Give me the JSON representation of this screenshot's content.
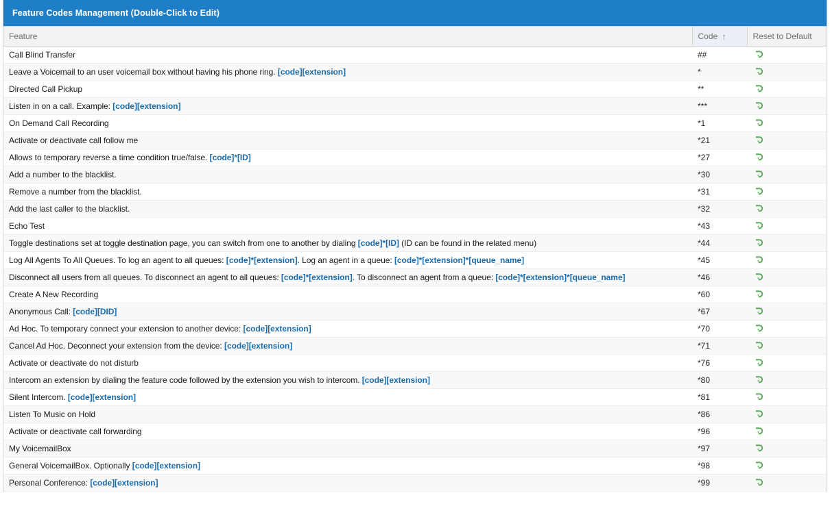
{
  "window": {
    "title": "Feature Codes Management (Double-Click to Edit)",
    "title_bar_color": "#1e7ec8"
  },
  "colors": {
    "accent": "#1e7ec8",
    "token_link": "#1b6cac",
    "reset_icon": "#5aad5a",
    "header_bg": "#f2f2f2",
    "sorted_header_bg": "#eaf0f6",
    "row_alt_bg": "#f8f8f8"
  },
  "table": {
    "columns": [
      {
        "key": "feature",
        "label": "Feature",
        "sorted": false
      },
      {
        "key": "code",
        "label": "Code",
        "sorted": true,
        "sort_direction": "ascending",
        "sort_glyph": "↑"
      },
      {
        "key": "reset",
        "label": "Reset to Default",
        "sorted": false
      }
    ],
    "reset_icon_name": "reset-arrow-icon",
    "rows": [
      {
        "parts": [
          {
            "text": "Call Blind Transfer",
            "type": "plain"
          }
        ],
        "code": "##"
      },
      {
        "parts": [
          {
            "text": "Leave a Voicemail to an user voicemail box without having his phone ring. ",
            "type": "plain"
          },
          {
            "text": "[code][extension]",
            "type": "token"
          }
        ],
        "code": "*"
      },
      {
        "parts": [
          {
            "text": "Directed Call Pickup",
            "type": "plain"
          }
        ],
        "code": "**"
      },
      {
        "parts": [
          {
            "text": "Listen in on a call. Example: ",
            "type": "plain"
          },
          {
            "text": "[code][extension]",
            "type": "token"
          }
        ],
        "code": "***"
      },
      {
        "parts": [
          {
            "text": "On Demand Call Recording",
            "type": "plain"
          }
        ],
        "code": "*1"
      },
      {
        "parts": [
          {
            "text": "Activate or deactivate call follow me",
            "type": "plain"
          }
        ],
        "code": "*21"
      },
      {
        "parts": [
          {
            "text": "Allows to temporary reverse a time condition true/false. ",
            "type": "plain"
          },
          {
            "text": "[code]*[ID]",
            "type": "token"
          }
        ],
        "code": "*27"
      },
      {
        "parts": [
          {
            "text": "Add a number to the blacklist.",
            "type": "plain"
          }
        ],
        "code": "*30"
      },
      {
        "parts": [
          {
            "text": "Remove a number from the blacklist.",
            "type": "plain"
          }
        ],
        "code": "*31"
      },
      {
        "parts": [
          {
            "text": "Add the last caller to the blacklist.",
            "type": "plain"
          }
        ],
        "code": "*32"
      },
      {
        "parts": [
          {
            "text": "Echo Test",
            "type": "plain"
          }
        ],
        "code": "*43"
      },
      {
        "parts": [
          {
            "text": "Toggle destinations set at toggle destination page, you can switch from one to another by dialing ",
            "type": "plain"
          },
          {
            "text": "[code]*[ID]",
            "type": "token"
          },
          {
            "text": " (ID can be found in the related menu)",
            "type": "plain"
          }
        ],
        "code": "*44"
      },
      {
        "parts": [
          {
            "text": "Log All Agents To All Queues. To log an agent to all queues: ",
            "type": "plain"
          },
          {
            "text": "[code]*[extension]",
            "type": "token"
          },
          {
            "text": ". Log an agent in a queue: ",
            "type": "plain"
          },
          {
            "text": "[code]*[extension]*[queue_name]",
            "type": "token"
          }
        ],
        "code": "*45"
      },
      {
        "parts": [
          {
            "text": "Disconnect all users from all queues. To disconnect an agent to all queues: ",
            "type": "plain"
          },
          {
            "text": "[code]*[extension]",
            "type": "token"
          },
          {
            "text": ". To disconnect an agent from a queue: ",
            "type": "plain"
          },
          {
            "text": "[code]*[extension]*[queue_name]",
            "type": "token"
          }
        ],
        "code": "*46"
      },
      {
        "parts": [
          {
            "text": "Create A New Recording",
            "type": "plain"
          }
        ],
        "code": "*60"
      },
      {
        "parts": [
          {
            "text": "Anonymous Call: ",
            "type": "plain"
          },
          {
            "text": "[code][DID]",
            "type": "token"
          }
        ],
        "code": "*67"
      },
      {
        "parts": [
          {
            "text": "Ad Hoc. To temporary connect your extension to another device: ",
            "type": "plain"
          },
          {
            "text": "[code][extension]",
            "type": "token"
          }
        ],
        "code": "*70"
      },
      {
        "parts": [
          {
            "text": "Cancel Ad Hoc. Deconnect your extension from the device: ",
            "type": "plain"
          },
          {
            "text": "[code][extension]",
            "type": "token"
          }
        ],
        "code": "*71"
      },
      {
        "parts": [
          {
            "text": "Activate or deactivate do not disturb",
            "type": "plain"
          }
        ],
        "code": "*76"
      },
      {
        "parts": [
          {
            "text": "Intercom an extension by dialing the feature code followed by the extension you wish to intercom. ",
            "type": "plain"
          },
          {
            "text": "[code][extension]",
            "type": "token"
          }
        ],
        "code": "*80"
      },
      {
        "parts": [
          {
            "text": "Silent Intercom. ",
            "type": "plain"
          },
          {
            "text": "[code][extension]",
            "type": "token"
          }
        ],
        "code": "*81"
      },
      {
        "parts": [
          {
            "text": "Listen To Music on Hold",
            "type": "plain"
          }
        ],
        "code": "*86"
      },
      {
        "parts": [
          {
            "text": "Activate or deactivate call forwarding",
            "type": "plain"
          }
        ],
        "code": "*96"
      },
      {
        "parts": [
          {
            "text": "My VoicemailBox",
            "type": "plain"
          }
        ],
        "code": "*97"
      },
      {
        "parts": [
          {
            "text": "General VoicemailBox. Optionally ",
            "type": "plain"
          },
          {
            "text": "[code][extension]",
            "type": "token"
          }
        ],
        "code": "*98"
      },
      {
        "parts": [
          {
            "text": "Personal Conference: ",
            "type": "plain"
          },
          {
            "text": "[code][extension]",
            "type": "token"
          }
        ],
        "code": "*99"
      }
    ]
  }
}
